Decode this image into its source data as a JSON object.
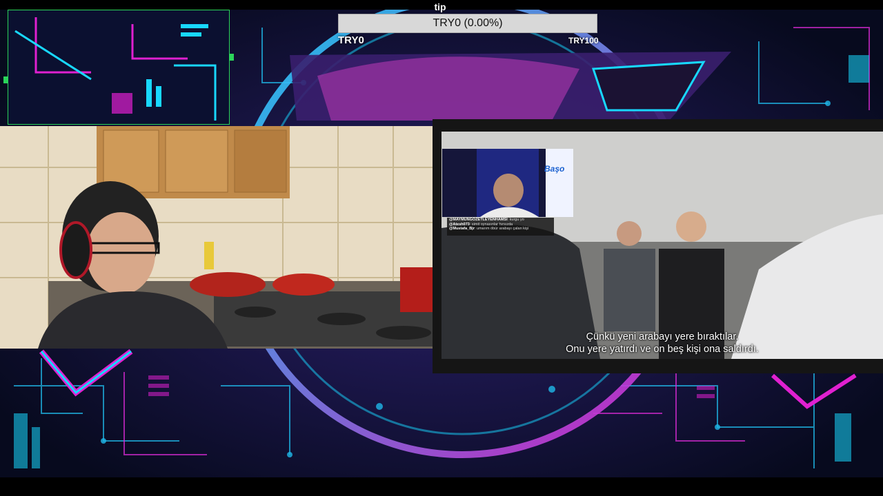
{
  "tip_goal": {
    "label": "tip",
    "progress_text": "TRY0 (0.00%)",
    "progress_fraction": 0.0,
    "min_label": "TRY0",
    "max_label": "TRY100"
  },
  "video": {
    "subtitles": [
      "Çünkü yeni arabayı yere bıraktılar.",
      "Onu yere yatırdı ve on beş kişi ona saldırdı."
    ],
    "pip_logo": "Başo",
    "chat": [
      {
        "user": "@MAYMUNGÖZETLEYENHAMSİ",
        "text": ": kurgu yo"
      },
      {
        "user": "@Atesh073",
        "text": ": simit oynasınlar hırsızda"
      },
      {
        "user": "@Mustafa_Bjr",
        "text": ": umarım öbür arabayı çalan kişi"
      }
    ]
  },
  "colors": {
    "neon_cyan": "#18d8ff",
    "neon_magenta": "#e020d0",
    "frame_green": "#2bd45a"
  }
}
